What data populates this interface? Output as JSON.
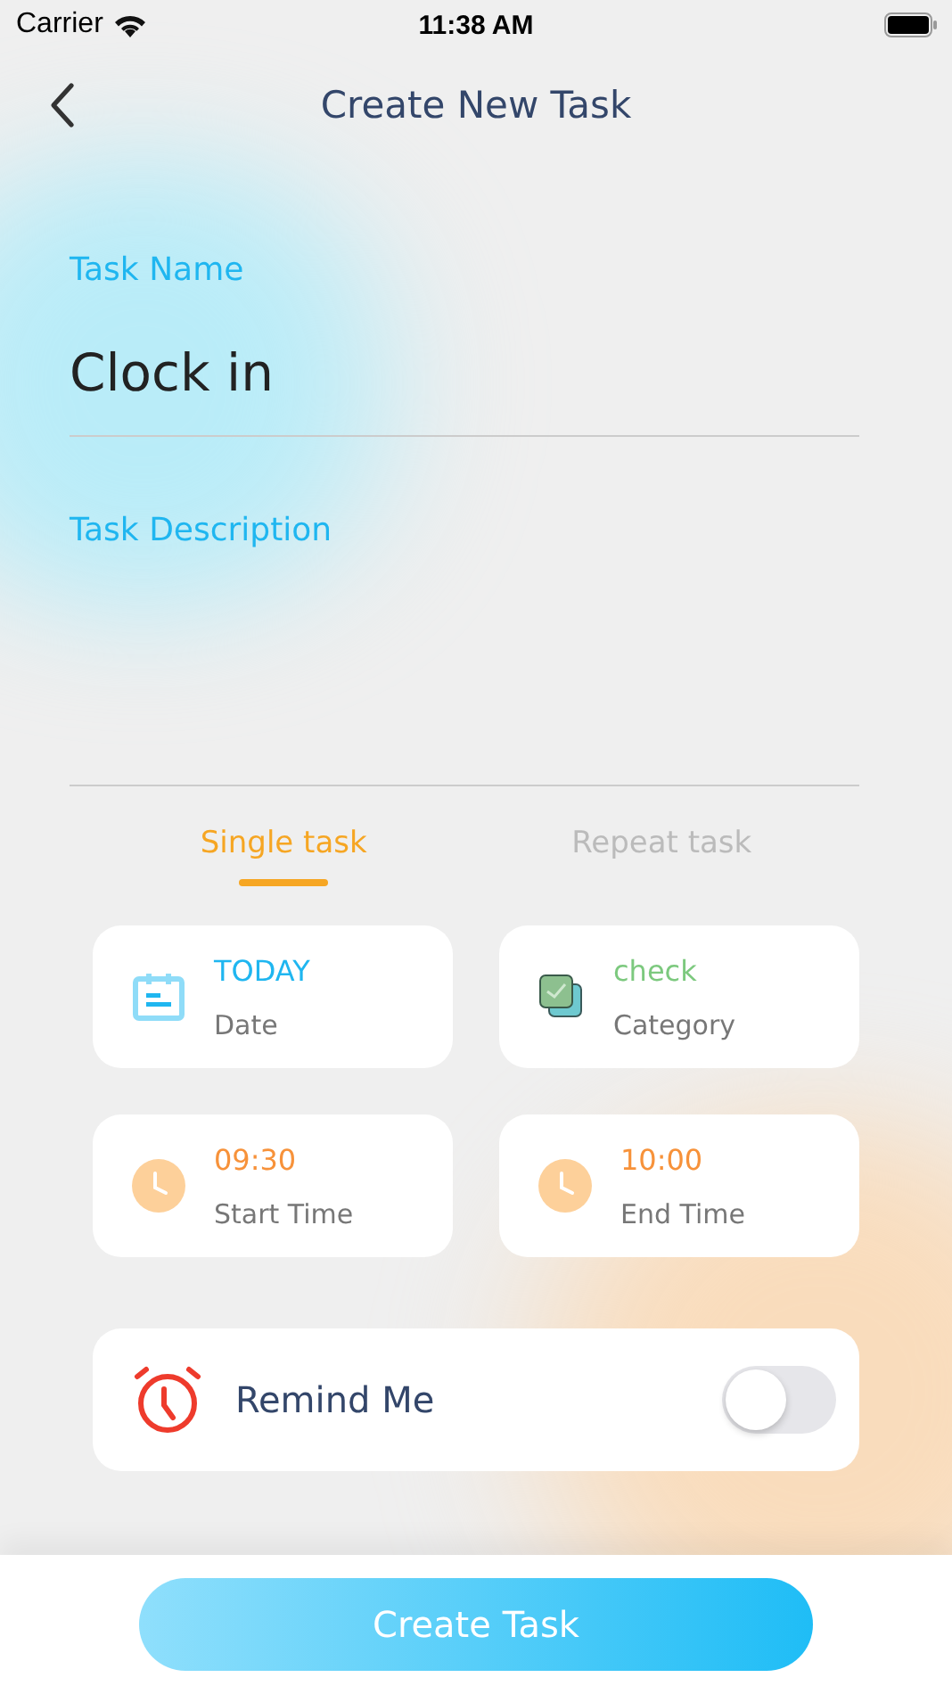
{
  "status_bar": {
    "carrier": "Carrier",
    "time": "11:38 AM"
  },
  "nav": {
    "title": "Create New Task"
  },
  "task_name": {
    "label": "Task Name",
    "value": "Clock in"
  },
  "task_description": {
    "label": "Task Description"
  },
  "tabs": [
    {
      "label": "Single task",
      "selected": true
    },
    {
      "label": "Repeat task",
      "selected": false
    }
  ],
  "cards": [
    {
      "kind": "date",
      "value": "TODAY",
      "label": "Date"
    },
    {
      "kind": "category",
      "value": "check",
      "label": "Category"
    },
    {
      "kind": "time",
      "value": "09:30",
      "label": "Start Time"
    },
    {
      "kind": "time",
      "value": "10:00",
      "label": "End Time"
    }
  ],
  "remind": {
    "label": "Remind Me",
    "on": false
  },
  "submit": {
    "label": "Create Task"
  }
}
